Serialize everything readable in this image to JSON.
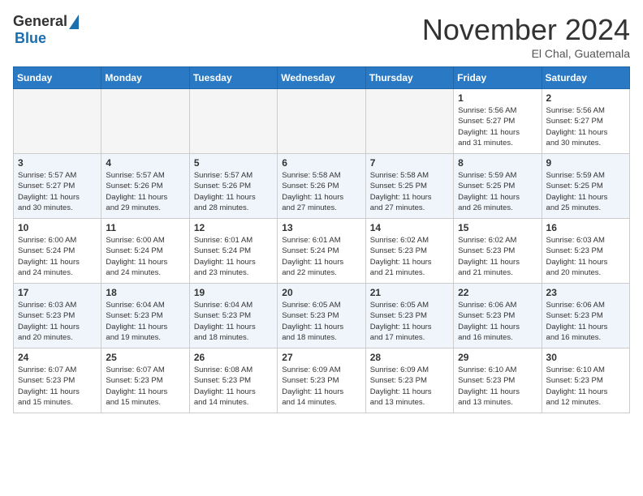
{
  "logo": {
    "general": "General",
    "blue": "Blue"
  },
  "header": {
    "month": "November 2024",
    "location": "El Chal, Guatemala"
  },
  "weekdays": [
    "Sunday",
    "Monday",
    "Tuesday",
    "Wednesday",
    "Thursday",
    "Friday",
    "Saturday"
  ],
  "weeks": [
    [
      {
        "day": "",
        "info": ""
      },
      {
        "day": "",
        "info": ""
      },
      {
        "day": "",
        "info": ""
      },
      {
        "day": "",
        "info": ""
      },
      {
        "day": "",
        "info": ""
      },
      {
        "day": "1",
        "info": "Sunrise: 5:56 AM\nSunset: 5:27 PM\nDaylight: 11 hours\nand 31 minutes."
      },
      {
        "day": "2",
        "info": "Sunrise: 5:56 AM\nSunset: 5:27 PM\nDaylight: 11 hours\nand 30 minutes."
      }
    ],
    [
      {
        "day": "3",
        "info": "Sunrise: 5:57 AM\nSunset: 5:27 PM\nDaylight: 11 hours\nand 30 minutes."
      },
      {
        "day": "4",
        "info": "Sunrise: 5:57 AM\nSunset: 5:26 PM\nDaylight: 11 hours\nand 29 minutes."
      },
      {
        "day": "5",
        "info": "Sunrise: 5:57 AM\nSunset: 5:26 PM\nDaylight: 11 hours\nand 28 minutes."
      },
      {
        "day": "6",
        "info": "Sunrise: 5:58 AM\nSunset: 5:26 PM\nDaylight: 11 hours\nand 27 minutes."
      },
      {
        "day": "7",
        "info": "Sunrise: 5:58 AM\nSunset: 5:25 PM\nDaylight: 11 hours\nand 27 minutes."
      },
      {
        "day": "8",
        "info": "Sunrise: 5:59 AM\nSunset: 5:25 PM\nDaylight: 11 hours\nand 26 minutes."
      },
      {
        "day": "9",
        "info": "Sunrise: 5:59 AM\nSunset: 5:25 PM\nDaylight: 11 hours\nand 25 minutes."
      }
    ],
    [
      {
        "day": "10",
        "info": "Sunrise: 6:00 AM\nSunset: 5:24 PM\nDaylight: 11 hours\nand 24 minutes."
      },
      {
        "day": "11",
        "info": "Sunrise: 6:00 AM\nSunset: 5:24 PM\nDaylight: 11 hours\nand 24 minutes."
      },
      {
        "day": "12",
        "info": "Sunrise: 6:01 AM\nSunset: 5:24 PM\nDaylight: 11 hours\nand 23 minutes."
      },
      {
        "day": "13",
        "info": "Sunrise: 6:01 AM\nSunset: 5:24 PM\nDaylight: 11 hours\nand 22 minutes."
      },
      {
        "day": "14",
        "info": "Sunrise: 6:02 AM\nSunset: 5:23 PM\nDaylight: 11 hours\nand 21 minutes."
      },
      {
        "day": "15",
        "info": "Sunrise: 6:02 AM\nSunset: 5:23 PM\nDaylight: 11 hours\nand 21 minutes."
      },
      {
        "day": "16",
        "info": "Sunrise: 6:03 AM\nSunset: 5:23 PM\nDaylight: 11 hours\nand 20 minutes."
      }
    ],
    [
      {
        "day": "17",
        "info": "Sunrise: 6:03 AM\nSunset: 5:23 PM\nDaylight: 11 hours\nand 20 minutes."
      },
      {
        "day": "18",
        "info": "Sunrise: 6:04 AM\nSunset: 5:23 PM\nDaylight: 11 hours\nand 19 minutes."
      },
      {
        "day": "19",
        "info": "Sunrise: 6:04 AM\nSunset: 5:23 PM\nDaylight: 11 hours\nand 18 minutes."
      },
      {
        "day": "20",
        "info": "Sunrise: 6:05 AM\nSunset: 5:23 PM\nDaylight: 11 hours\nand 18 minutes."
      },
      {
        "day": "21",
        "info": "Sunrise: 6:05 AM\nSunset: 5:23 PM\nDaylight: 11 hours\nand 17 minutes."
      },
      {
        "day": "22",
        "info": "Sunrise: 6:06 AM\nSunset: 5:23 PM\nDaylight: 11 hours\nand 16 minutes."
      },
      {
        "day": "23",
        "info": "Sunrise: 6:06 AM\nSunset: 5:23 PM\nDaylight: 11 hours\nand 16 minutes."
      }
    ],
    [
      {
        "day": "24",
        "info": "Sunrise: 6:07 AM\nSunset: 5:23 PM\nDaylight: 11 hours\nand 15 minutes."
      },
      {
        "day": "25",
        "info": "Sunrise: 6:07 AM\nSunset: 5:23 PM\nDaylight: 11 hours\nand 15 minutes."
      },
      {
        "day": "26",
        "info": "Sunrise: 6:08 AM\nSunset: 5:23 PM\nDaylight: 11 hours\nand 14 minutes."
      },
      {
        "day": "27",
        "info": "Sunrise: 6:09 AM\nSunset: 5:23 PM\nDaylight: 11 hours\nand 14 minutes."
      },
      {
        "day": "28",
        "info": "Sunrise: 6:09 AM\nSunset: 5:23 PM\nDaylight: 11 hours\nand 13 minutes."
      },
      {
        "day": "29",
        "info": "Sunrise: 6:10 AM\nSunset: 5:23 PM\nDaylight: 11 hours\nand 13 minutes."
      },
      {
        "day": "30",
        "info": "Sunrise: 6:10 AM\nSunset: 5:23 PM\nDaylight: 11 hours\nand 12 minutes."
      }
    ]
  ]
}
